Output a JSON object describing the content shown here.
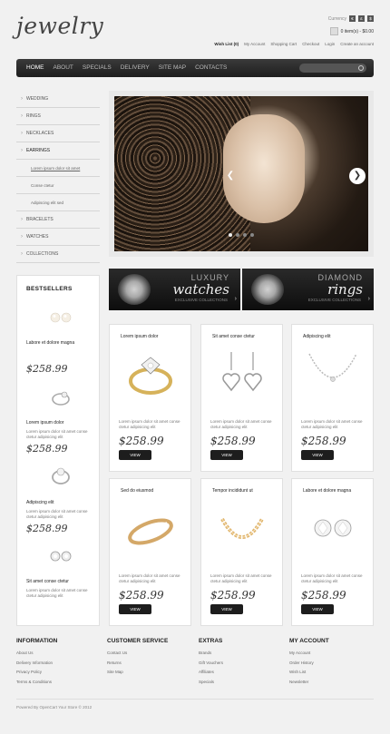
{
  "header": {
    "logo": "jewelry",
    "currency_label": "Currency",
    "currency_buttons": [
      "€",
      "£",
      "$"
    ],
    "cart_text": "0 item(s) - $0.00",
    "top_links": [
      "Wish List (0)",
      "My Account",
      "Shopping Cart",
      "Checkout",
      "Login",
      "Create an account"
    ]
  },
  "nav": {
    "items": [
      "Home",
      "About",
      "Specials",
      "Delivery",
      "Site map",
      "Contacts"
    ],
    "active_index": 0
  },
  "categories": [
    {
      "label": "Wedding",
      "type": "top"
    },
    {
      "label": "Rings",
      "type": "top"
    },
    {
      "label": "Necklaces",
      "type": "top"
    },
    {
      "label": "Earrings",
      "type": "open"
    },
    {
      "label": "Lorem ipsum dolor sit amet",
      "type": "sub"
    },
    {
      "label": "Conse ctetur",
      "type": "sub"
    },
    {
      "label": "Adipiscing elit sed",
      "type": "sub"
    },
    {
      "label": "Bracelets",
      "type": "top"
    },
    {
      "label": "Watches",
      "type": "top"
    },
    {
      "label": "Collections",
      "type": "top"
    }
  ],
  "banners": [
    {
      "top": "LUXURY",
      "main": "watches",
      "sub": "EXCLUSIVE COLLECTIONS"
    },
    {
      "top": "DIAMOND",
      "main": "rings",
      "sub": "EXCLUSIVE COLLECTIONS"
    }
  ],
  "bestsellers": {
    "title": "BESTSELLERS",
    "items": [
      {
        "name": "Labore et dolore magna",
        "desc": "",
        "price": "$258.99",
        "icon": "pearl-earrings-icon"
      },
      {
        "name": "Lorem ipsum dolor",
        "desc": "Lorem ipsum dolor sit amet conse ctetur adipisicing elit",
        "price": "$258.99",
        "icon": "diamond-ring-icon"
      },
      {
        "name": "Adipiscing elit",
        "desc": "Lorem ipsum dolor sit amet conse ctetur adipisicing elit",
        "price": "$258.99",
        "icon": "solitaire-ring-icon"
      },
      {
        "name": "Sit amet conse ctetur",
        "desc": "Lorem ipsum dolor sit amet conse ctetur adipisicing elit",
        "price": "",
        "icon": "stud-earrings-icon"
      }
    ]
  },
  "products": [
    {
      "title": "Lorem ipsum dolor",
      "desc": "Lorem ipsum dolor sit amet conse ctetur adipisicing elit",
      "price": "$258.99",
      "button": "View",
      "icon": "gold-ring-icon"
    },
    {
      "title": "Sit amet conse ctetur",
      "desc": "Lorem ipsum dolor sit amet conse ctetur adipisicing elit",
      "price": "$258.99",
      "button": "View",
      "icon": "heart-earrings-icon"
    },
    {
      "title": "Adipiscing elit",
      "desc": "Lorem ipsum dolor sit amet conse ctetur adipisicing elit",
      "price": "$258.99",
      "button": "View",
      "icon": "silver-necklace-icon"
    },
    {
      "title": "Sed do eiusmod",
      "desc": "Lorem ipsum dolor sit amet conse ctetur adipisicing elit",
      "price": "$258.99",
      "button": "View",
      "icon": "band-ring-icon"
    },
    {
      "title": "Tempor incididunt ut",
      "desc": "Lorem ipsum dolor sit amet conse ctetur adipisicing elit",
      "price": "$258.99",
      "button": "View",
      "icon": "gold-bracelet-icon"
    },
    {
      "title": "Labore et dolore magna",
      "desc": "Lorem ipsum dolor sit amet conse ctetur adipisicing elit",
      "price": "$258.99",
      "button": "View",
      "icon": "diamond-studs-icon"
    }
  ],
  "footer": {
    "columns": [
      {
        "title": "Information",
        "links": [
          "About Us",
          "Delivery Information",
          "Privacy Policy",
          "Terms & Conditions"
        ]
      },
      {
        "title": "Customer Service",
        "links": [
          "Contact Us",
          "Returns",
          "Site Map"
        ]
      },
      {
        "title": "Extras",
        "links": [
          "Brands",
          "Gift Vouchers",
          "Affiliates",
          "Specials"
        ]
      },
      {
        "title": "My Account",
        "links": [
          "My Account",
          "Order History",
          "Wish List",
          "Newsletter"
        ]
      }
    ],
    "powered": "Powered By OpenCart Your Store © 2012"
  }
}
